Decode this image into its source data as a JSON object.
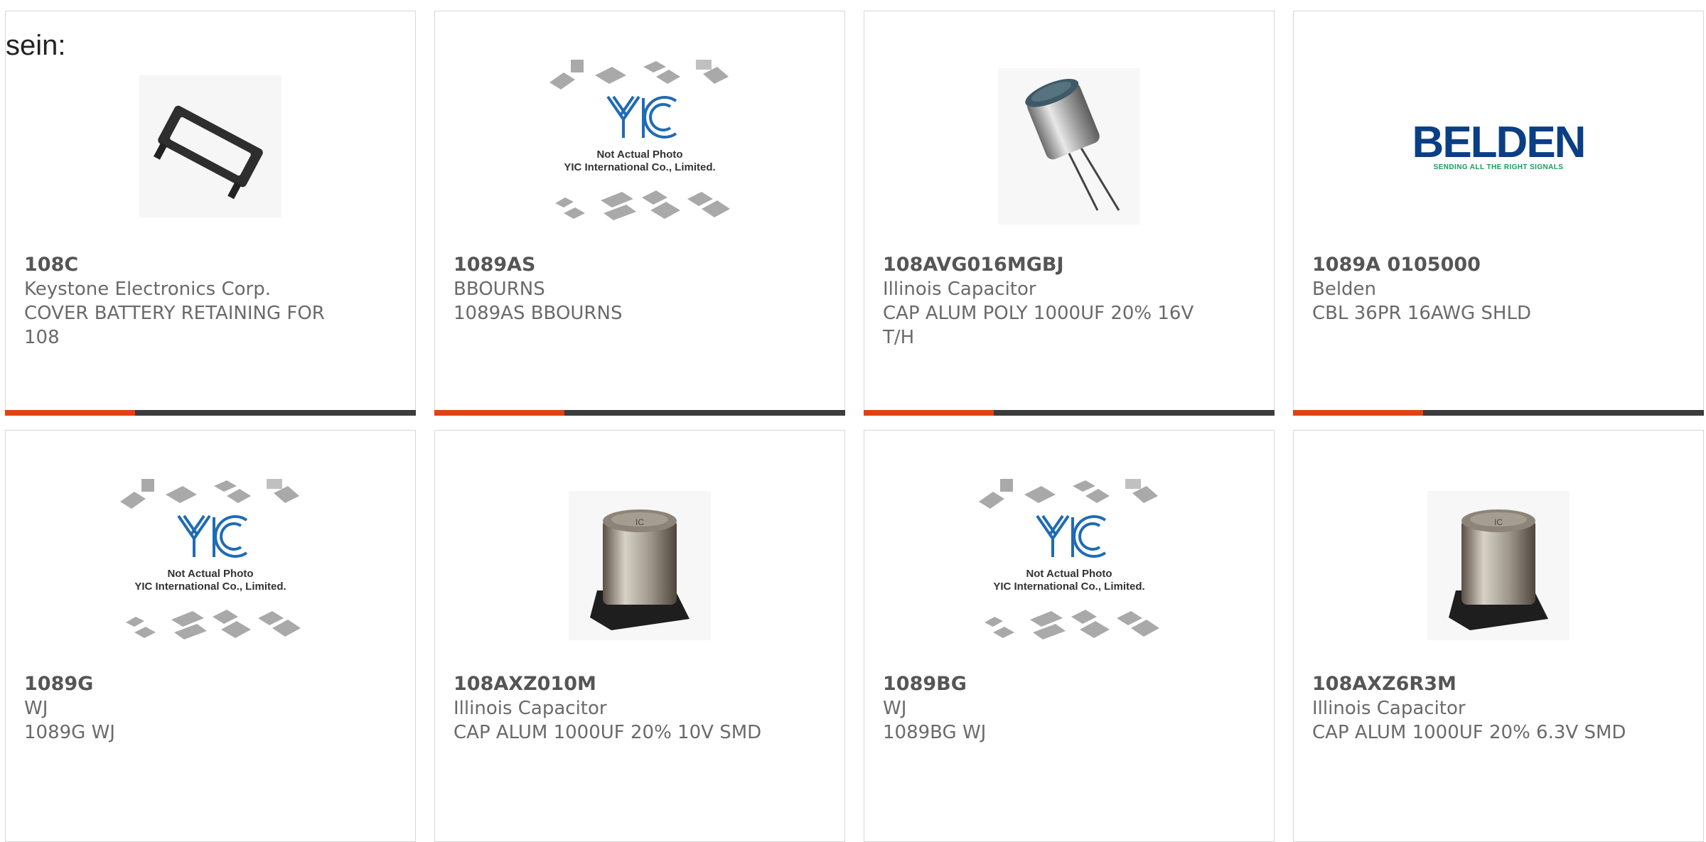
{
  "intro_text": "sein:",
  "accent_color": "#e04216",
  "placeholder_image": {
    "caption_line1": "Not Actual Photo",
    "caption_line2": "YIC International Co., Limited."
  },
  "belden_logo": {
    "wordmark": "BELDEN",
    "tagline": "SENDING ALL THE RIGHT SIGNALS",
    "color": "#0a3f85",
    "tagline_color": "#1a9a5a"
  },
  "products": [
    {
      "part": "108C",
      "manufacturer": "Keystone Electronics Corp.",
      "description": "COVER BATTERY RETAINING FOR 108",
      "image": "battery-retainer-cover"
    },
    {
      "part": "1089AS",
      "manufacturer": "BBOURNS",
      "description": "1089AS BBOURNS",
      "image": "placeholder"
    },
    {
      "part": "108AVG016MGBJ",
      "manufacturer": "Illinois Capacitor",
      "description": "CAP ALUM POLY 1000UF 20% 16V T/H",
      "image": "through-hole-capacitor"
    },
    {
      "part": "1089A 0105000",
      "manufacturer": "Belden",
      "description": "CBL 36PR 16AWG SHLD",
      "image": "belden-logo"
    },
    {
      "part": "1089G",
      "manufacturer": "WJ",
      "description": "1089G WJ",
      "image": "placeholder"
    },
    {
      "part": "108AXZ010M",
      "manufacturer": "Illinois Capacitor",
      "description": "CAP ALUM 1000UF 20% 10V SMD",
      "image": "smd-capacitor"
    },
    {
      "part": "1089BG",
      "manufacturer": "WJ",
      "description": "1089BG WJ",
      "image": "placeholder"
    },
    {
      "part": "108AXZ6R3M",
      "manufacturer": "Illinois Capacitor",
      "description": "CAP ALUM 1000UF 20% 6.3V SMD",
      "image": "smd-capacitor"
    }
  ]
}
